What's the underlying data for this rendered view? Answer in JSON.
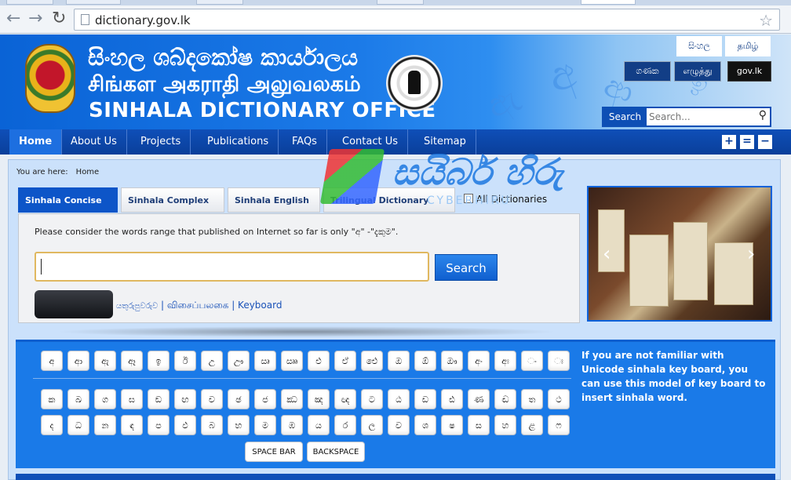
{
  "browser": {
    "url": "dictionary.gov.lk"
  },
  "header": {
    "title_sinhala": "සිංහල ශබ්දකෝෂ කාර්යාලය",
    "title_tamil": "சிங்கள அகராதி அலுவலகம்",
    "title_english": "SINHALA DICTIONARY OFFICE",
    "lang_sinhala": "සිංහල",
    "lang_tamil": "தமிழ்",
    "link_ganaka": "ගණක",
    "link_ezhuththu": "எழுத்து",
    "link_govlk": "gov.lk",
    "search_label": "Search",
    "search_placeholder": "Search..."
  },
  "menu": {
    "items": [
      "Home",
      "About Us",
      "Projects",
      "Publications",
      "FAQs",
      "Contact Us",
      "Sitemap"
    ],
    "active": "Home"
  },
  "content": {
    "breadcrumb_prefix": "You are here:",
    "breadcrumb_current": "Home",
    "tabs": [
      "Sinhala Concise",
      "Sinhala Complex",
      "Sinhala English",
      "Trilingual Dictionary"
    ],
    "active_tab": "Sinhala Concise",
    "all_dictionaries_label": "All Dictionaries",
    "notice": "Please consider the words range that published on Internet so far is only \"අ\" -\"දැකුම\".",
    "search_button": "Search",
    "keyboard_link_sinhala": "යතුරුපුවරුව",
    "keyboard_link_tamil": "விசைப்பலகை",
    "keyboard_link_english": "Keyboard"
  },
  "keyboard": {
    "row1": [
      "අ",
      "ආ",
      "ඇ",
      "ඈ",
      "ඉ",
      "ඊ",
      "උ",
      "ඌ",
      "ඍ",
      "ඎ",
      "එ",
      "ඒ",
      "ඓ",
      "ඔ",
      "ඕ",
      "ඖ",
      "අං",
      "අඃ",
      "ං",
      "ඃ"
    ],
    "row2": [
      "ක",
      "ඛ",
      "ග",
      "ඝ",
      "ඞ",
      "ඟ",
      "ච",
      "ඡ",
      "ජ",
      "ඣ",
      "ඤ",
      "ඥ",
      "ට",
      "ඨ",
      "ඩ",
      "ඪ",
      "ණ",
      "ඬ",
      "ත",
      "ථ"
    ],
    "row3": [
      "ද",
      "ධ",
      "න",
      "ඳ",
      "ප",
      "ඵ",
      "බ",
      "භ",
      "ම",
      "ඹ",
      "ය",
      "ර",
      "ල",
      "ව",
      "ශ",
      "ෂ",
      "ස",
      "හ",
      "ළ",
      "ෆ"
    ],
    "space_label": "SPACE BAR",
    "backspace_label": "BACKSPACE",
    "help_text": "If you are not familiar with Unicode sinhala key board, you can use this model of key board to insert sinhala word."
  },
  "watermark": {
    "text": "සයිබර් හිරු",
    "sub": "CYBERHIRU"
  },
  "colors": {
    "header_blue": "#0a63d6",
    "menu_blue": "#0a3f9a",
    "keyboard_blue": "#1a7ae8"
  }
}
